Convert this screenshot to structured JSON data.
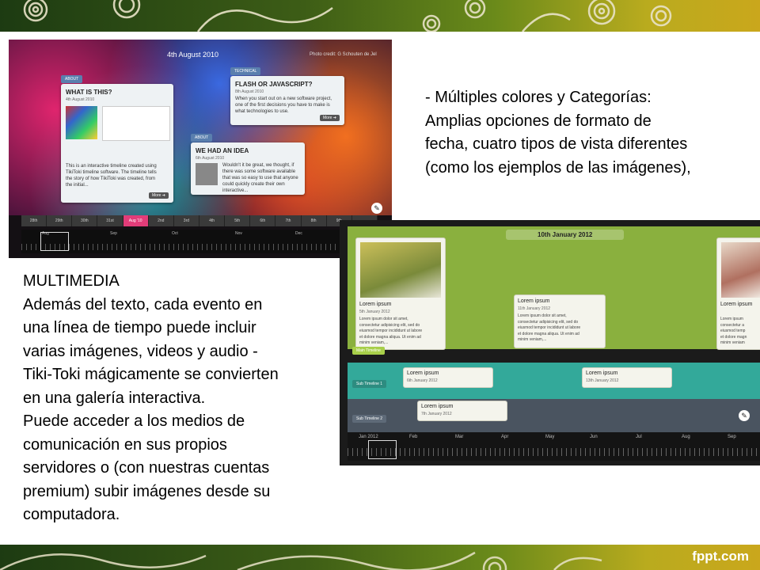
{
  "slide": {
    "brand": "fppt.com",
    "colors": {
      "band_dark": "#1d3b12",
      "band_light": "#caa71c",
      "accent_pink": "#e23c79",
      "green": "#8ab03e",
      "teal": "#33a99a"
    },
    "right_text": [
      "- Múltiples colores y Categorías:",
      "Amplias opciones de formato de",
      "fecha, cuatro tipos de vista diferentes",
      "(como los ejemplos de las imágenes),"
    ],
    "left_text": [
      "MULTIMEDIA",
      "Además del texto, cada evento en",
      "una línea de tiempo puede incluir",
      "varias imágenes, videos y audio -",
      "Tiki-Toki mágicamente se convierten",
      "en una galería interactiva.",
      "Puede acceder a los medios de",
      "comunicación en sus propios",
      "servidores o (con nuestras cuentas",
      "premium) subir imágenes desde su",
      "computadora."
    ]
  },
  "shot1": {
    "title": "4th August 2010",
    "credit": "Photo credit: G Schouten de Jel",
    "cards": [
      {
        "category": "ABOUT",
        "heading": "WHAT IS THIS?",
        "date": "4th August 2010",
        "body": [
          "This is an interactive timeline created using",
          "TikiToki timeline software. The timeline tells",
          "the story of how TikiToki was created, from",
          "the initial..."
        ],
        "more": "More ➜"
      },
      {
        "category": "TECHNICAL",
        "heading": "FLASH OR JAVASCRIPT?",
        "date": "8th August 2010",
        "body": [
          "When you start out on a new software project,",
          "one of the first decisions you have to make is",
          "what technologies to use."
        ],
        "more": "More ➜"
      },
      {
        "category": "ABOUT",
        "heading": "WE HAD AN IDEA",
        "date": "6th August 2010",
        "body": [
          "Wouldn't it be great, we thought, if",
          "there was some software available",
          "that was so easy to use that anyone",
          "could quickly create their own",
          "interactive..."
        ],
        "more": "More ➜"
      }
    ],
    "dates": [
      "28th",
      "29th",
      "30th",
      "31st",
      "Aug '10",
      "2nd",
      "3rd",
      "4th",
      "5th",
      "6th",
      "7th",
      "8th",
      "9th",
      ""
    ],
    "months": [
      "Aug",
      "Sep",
      "Oct",
      "Nov",
      "Dec"
    ]
  },
  "shot2": {
    "title": "10th January 2012",
    "cards": [
      {
        "heading": "Lorem ipsum",
        "date": "5th January 2012",
        "body": [
          "Lorem ipsum dolor sit amet,",
          "consectetur adipisicing elit, sed do",
          "eiusmod tempor incididunt ut labore",
          "et dolore magna aliqua. Ut enim ad",
          "minim veniam,..."
        ]
      },
      {
        "heading": "Lorem ipsum",
        "date": "11th January 2012",
        "body": [
          "Lorem ipsum dolor sit amet,",
          "consectetur adipisicing elit, sed do",
          "eiusmod tempor incididunt ut labore",
          "et dolore magna aliqua. Ut enim ad",
          "minim veniam,..."
        ]
      },
      {
        "heading": "Lorem ipsum",
        "date": "",
        "body": [
          "Lorem ipsum",
          "consectetur a",
          "eiusmod temp",
          "et dolore magn",
          "minim veniam"
        ]
      }
    ],
    "sub_cards": [
      {
        "heading": "Lorem ipsum",
        "date": "6th January 2012"
      },
      {
        "heading": "Lorem ipsum",
        "date": "13th January 2012"
      },
      {
        "heading": "Lorem ipsum",
        "date": "7th January 2012"
      }
    ],
    "labels": {
      "main": "Main Timeline",
      "sub1": "Sub Timeline 1",
      "sub2": "Sub Timeline 2"
    },
    "months": [
      "Jan 2012",
      "Feb",
      "Mar",
      "Apr",
      "May",
      "Jun",
      "Jul",
      "Aug",
      "Sep"
    ]
  }
}
